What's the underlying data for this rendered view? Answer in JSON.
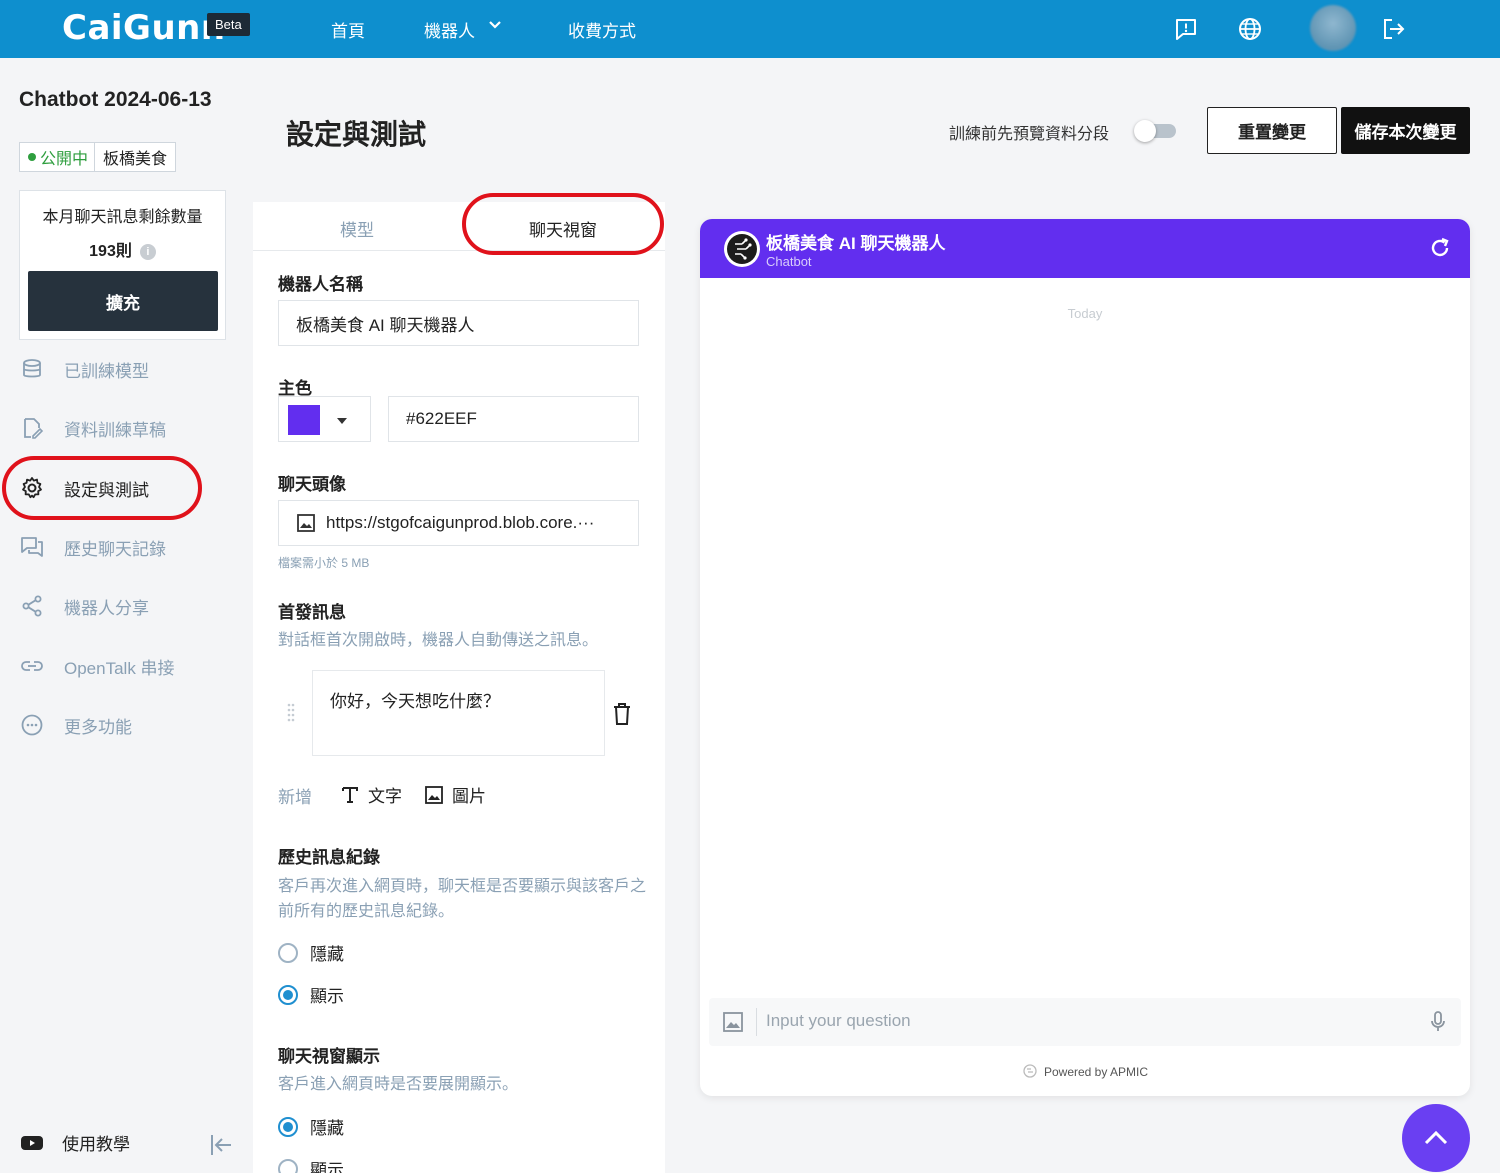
{
  "header": {
    "brand": "CaiGunn",
    "beta": "Beta",
    "nav": [
      "首頁",
      "機器人",
      "收費方式"
    ]
  },
  "sidebar": {
    "bot_title": "Chatbot 2024-06-13",
    "status": "公開中",
    "bot_name": "板橋美食",
    "quota_label": "本月聊天訊息剩餘數量",
    "quota_value": "193則",
    "expand_label": "擴充",
    "items": [
      {
        "label": "已訓練模型",
        "icon": "database-icon"
      },
      {
        "label": "資料訓練草稿",
        "icon": "edit-document-icon"
      },
      {
        "label": "設定與測試",
        "icon": "gear-icon",
        "active": true
      },
      {
        "label": "歷史聊天記錄",
        "icon": "chat-history-icon"
      },
      {
        "label": "機器人分享",
        "icon": "share-icon"
      },
      {
        "label": "OpenTalk 串接",
        "icon": "link-icon"
      },
      {
        "label": "更多功能",
        "icon": "more-icon"
      }
    ],
    "tutorial": "使用教學"
  },
  "page": {
    "title": "設定與測試",
    "toggle_label": "訓練前先預覽資料分段",
    "toggle_on": false,
    "reset_label": "重置變更",
    "save_label": "儲存本次變更"
  },
  "settings": {
    "tabs": [
      "模型",
      "聊天視窗"
    ],
    "active_tab": "聊天視窗",
    "name_label": "機器人名稱",
    "name_value": "板橋美食 AI 聊天機器人",
    "color_label": "主色",
    "color_value": "#622EEF",
    "avatar_label": "聊天頭像",
    "avatar_value": "https://stgofcaigunprod.blob.core.···",
    "avatar_hint": "檔案需小於 5 MB",
    "first_msg_label": "首發訊息",
    "first_msg_desc": "對話框首次開啟時，機器人自動傳送之訊息。",
    "first_msg_value": "你好，今天想吃什麼？",
    "add_label": "新增",
    "add_text": "文字",
    "add_image": "圖片",
    "history_label": "歷史訊息紀錄",
    "history_desc": "客戶再次進入網頁時，聊天框是否要顯示與該客戶之前所有的歷史訊息紀錄。",
    "history_options": [
      "隱藏",
      "顯示"
    ],
    "history_selected": "顯示",
    "display_label": "聊天視窗顯示",
    "display_desc": "客戶進入網頁時是否要展開顯示。",
    "display_options": [
      "隱藏",
      "顯示"
    ],
    "display_selected": "隱藏"
  },
  "chat": {
    "title": "板橋美食 AI 聊天機器人",
    "subtitle": "Chatbot",
    "today": "Today",
    "placeholder": "Input your question",
    "powered": "Powered by APMIC",
    "header_color": "#622EEF"
  }
}
